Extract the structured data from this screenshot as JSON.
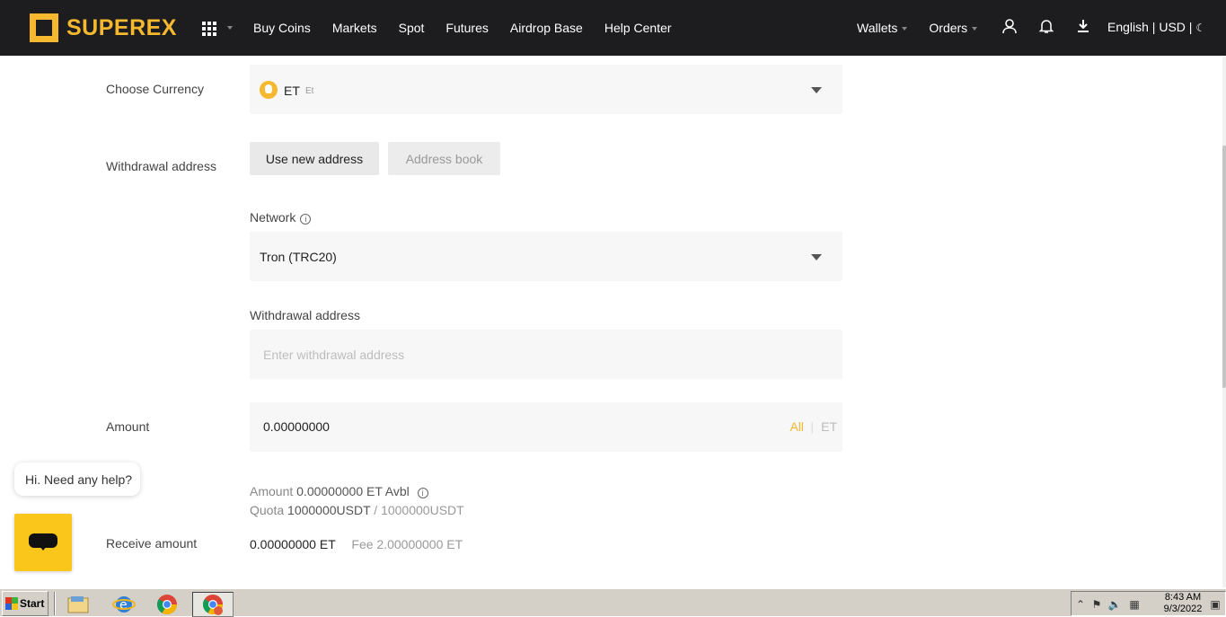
{
  "brand": {
    "name": "SUPEREX",
    "color": "#f5b82e"
  },
  "nav": {
    "left": [
      "Buy Coins",
      "Markets",
      "Spot",
      "Futures",
      "Airdrop Base",
      "Help Center"
    ],
    "wallets": "Wallets",
    "orders": "Orders",
    "lang": "English | USD |"
  },
  "form": {
    "currency_label": "Choose Currency",
    "currency": {
      "symbol": "ET",
      "name": "Et"
    },
    "address_label": "Withdrawal address",
    "tabs": {
      "new": "Use new address",
      "book": "Address book"
    },
    "network_label": "Network",
    "network_value": "Tron (TRC20)",
    "address_field_label": "Withdrawal address",
    "address_placeholder": "Enter withdrawal address",
    "amount_label": "Amount",
    "amount_value": "0.00000000",
    "amount_all": "All",
    "amount_sep": "|",
    "amount_unit": "ET",
    "avbl_prefix": "Amount",
    "avbl_value": "0.00000000 ET Avbl",
    "quota_prefix": "Quota",
    "quota_value": "1000000USDT",
    "quota_total": "/ 1000000USDT",
    "receive_label": "Receive amount",
    "receive_value": "0.00000000 ET",
    "fee_value": "Fee 2.00000000 ET"
  },
  "help": {
    "bubble": "Hi. Need any help?"
  },
  "taskbar": {
    "start": "Start",
    "time": "8:43 AM",
    "date": "9/3/2022"
  },
  "icons": {
    "grid": "apps-grid-icon",
    "user": "user-icon",
    "bell": "bell-icon",
    "download": "download-icon",
    "moon": "moon-icon",
    "info": "info-icon",
    "chat": "chat-icon"
  }
}
